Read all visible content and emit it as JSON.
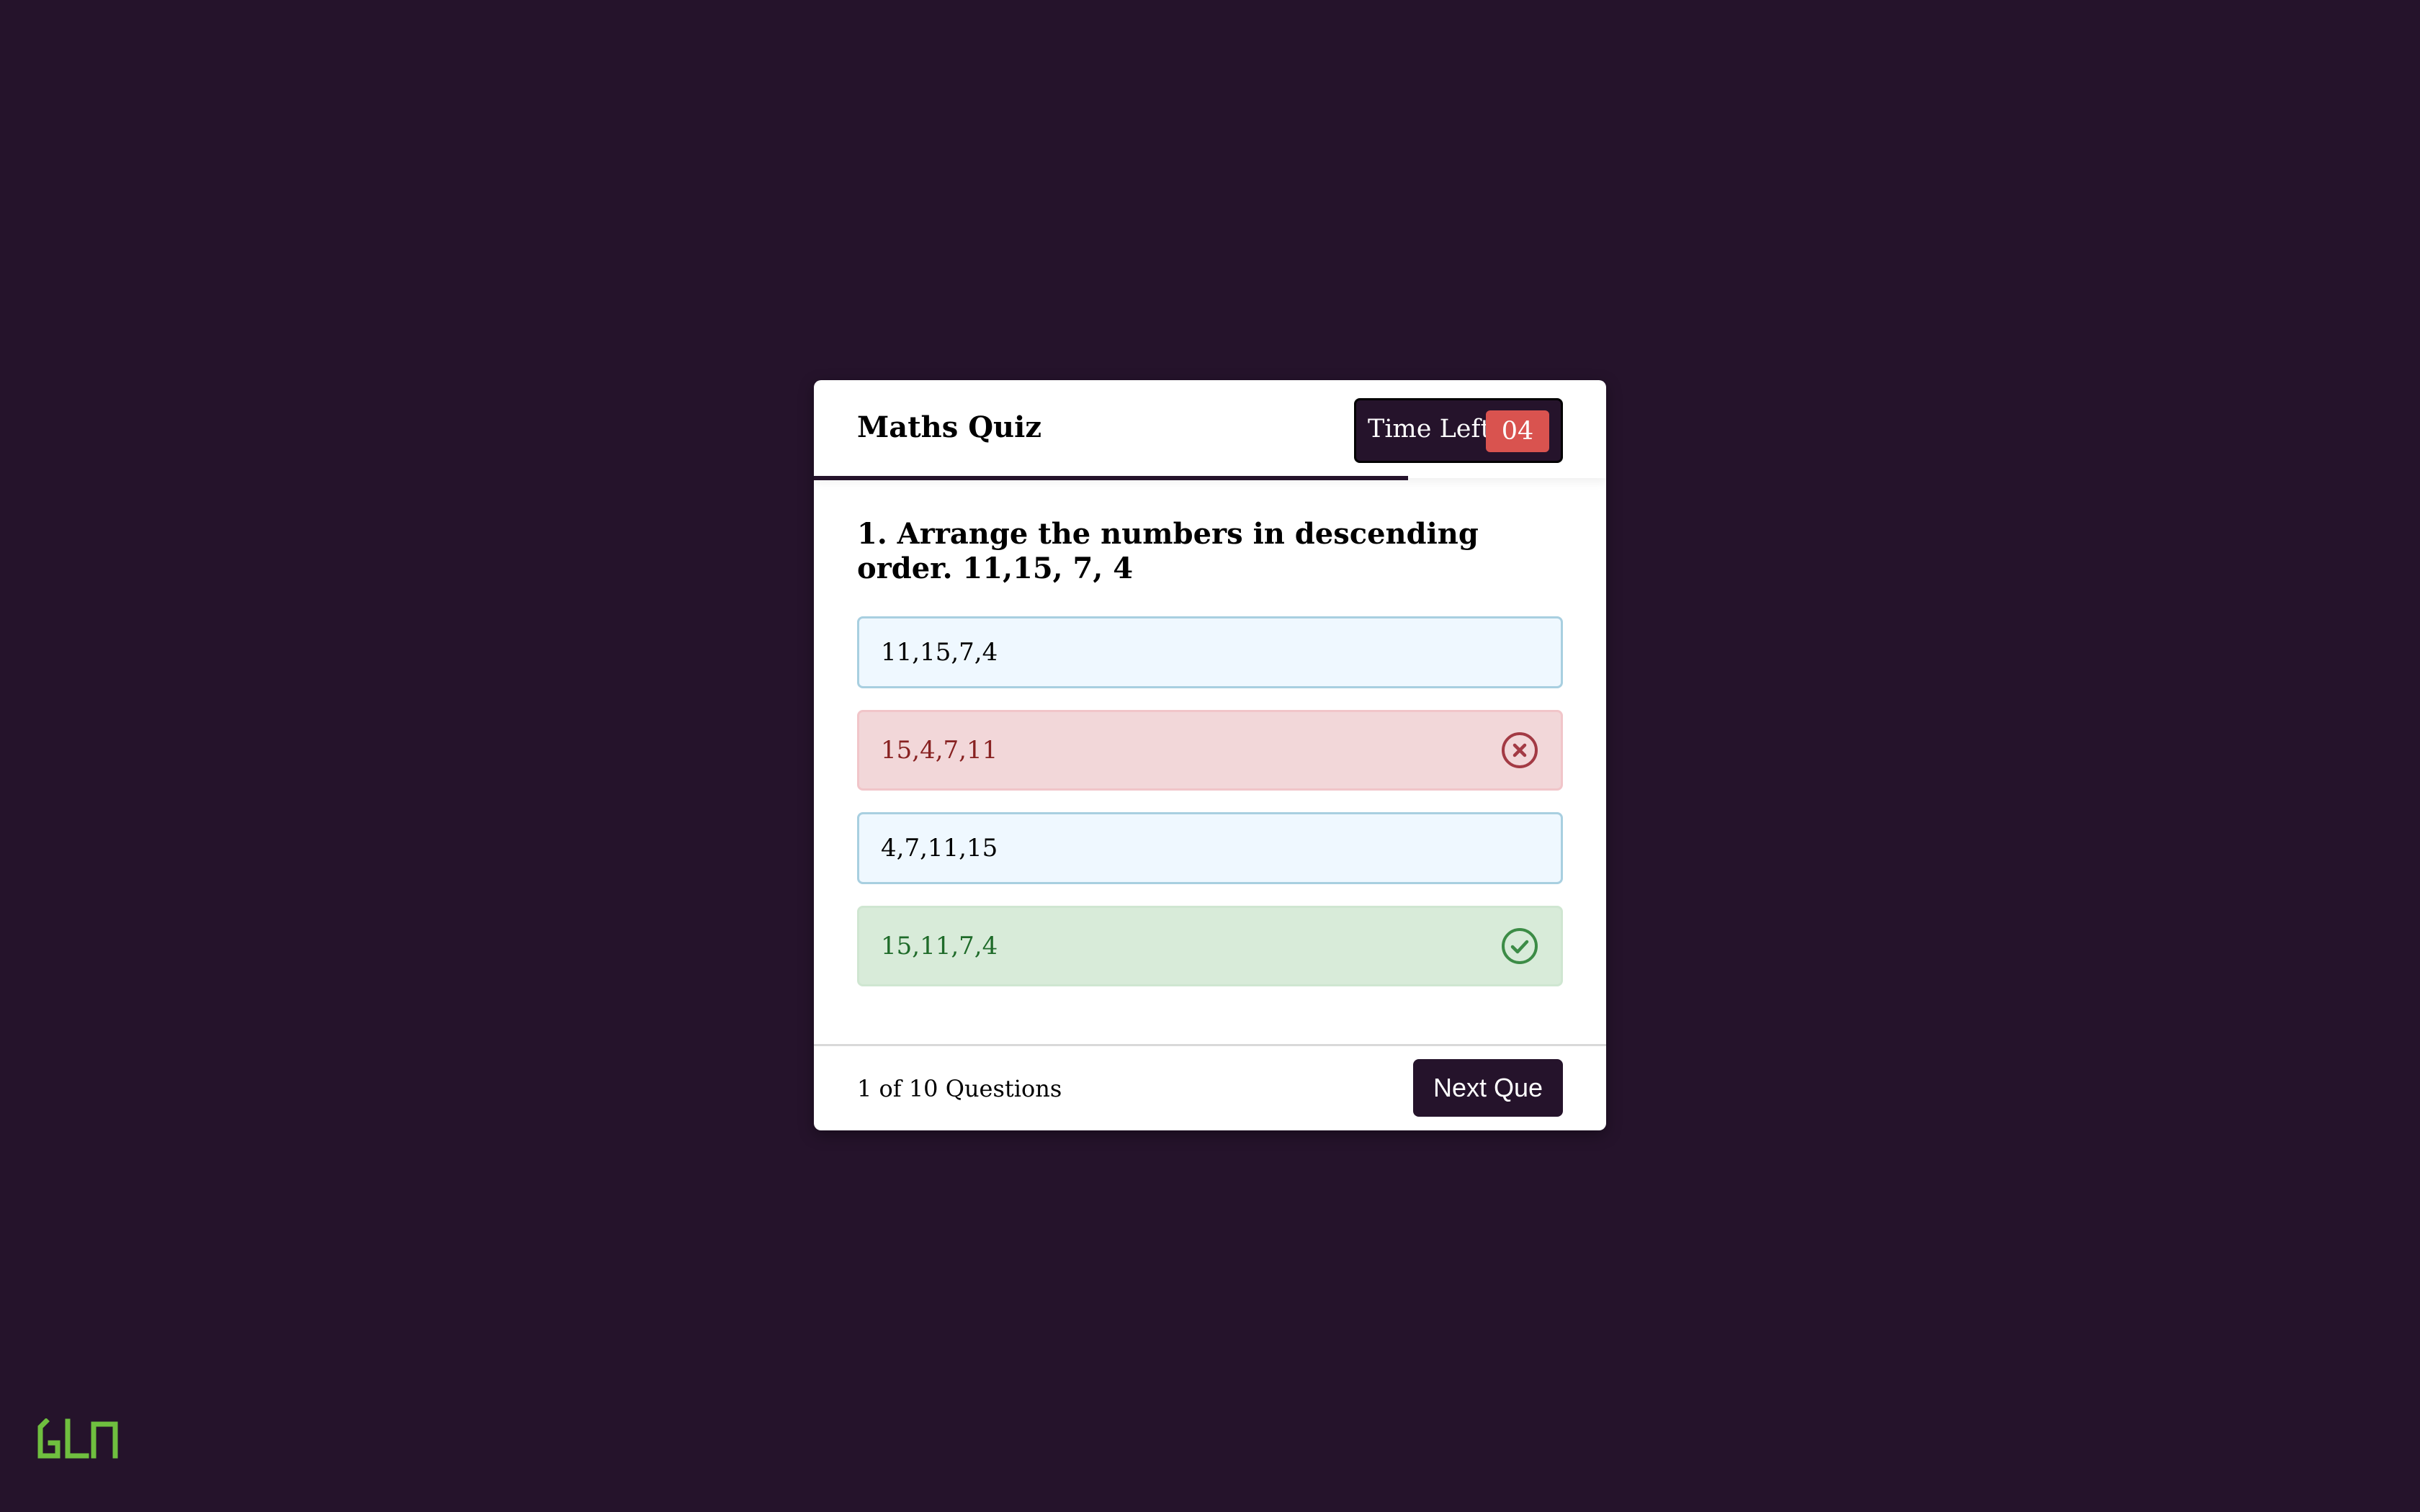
{
  "quiz": {
    "title": "Maths Quiz",
    "timer": {
      "label": "Time Left",
      "value": "04"
    },
    "progress_fraction": 0.75,
    "question": {
      "text": "1. Arrange the numbers in descending order. 11,15, 7, 4"
    },
    "options": [
      {
        "label": "11,15,7,4",
        "state": "neutral"
      },
      {
        "label": "15,4,7,11",
        "state": "wrong",
        "icon": "x-circle-icon"
      },
      {
        "label": "4,7,11,15",
        "state": "neutral"
      },
      {
        "label": "15,11,7,4",
        "state": "correct",
        "icon": "check-circle-icon"
      }
    ],
    "footer": {
      "question_count": "1 of 10 Questions",
      "next_label": "Next Que"
    }
  },
  "colors": {
    "background": "#25132b",
    "timer_badge": "#d9534f",
    "wrong": "#a33a44",
    "correct": "#3c8c46",
    "logo": "#6fbf3f"
  },
  "logo": {
    "icon": "brand-logo-icon"
  }
}
